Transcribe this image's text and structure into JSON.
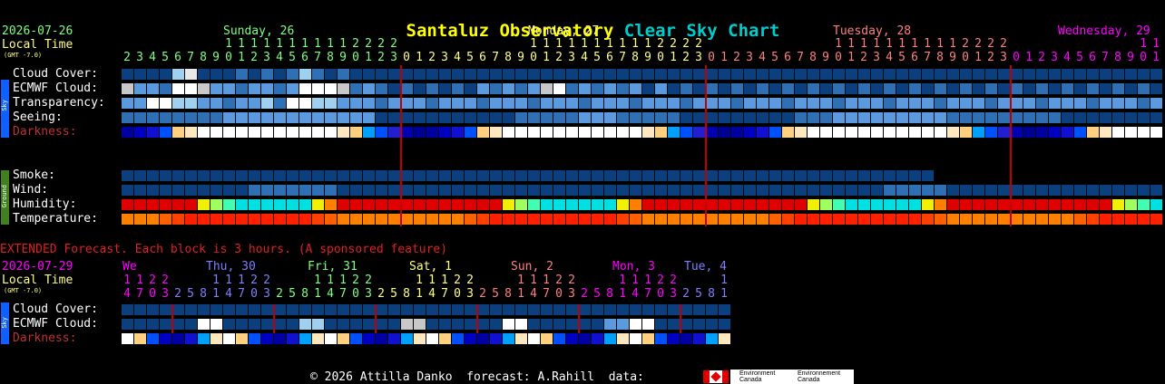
{
  "header": {
    "title_left": "Santaluz Observatory",
    "title_right": "Clear Sky Chart",
    "title_left_color": "#ffff00",
    "title_right_color": "#00cccc"
  },
  "top": {
    "date": "2026-07-26",
    "local_time": "Local Time",
    "gmt": "(GMT -7.0)",
    "days": [
      {
        "label": "Sunday, 26",
        "color": "#7fff7f"
      },
      {
        "label": "Monday, 27",
        "color": "#ffff7f"
      },
      {
        "label": "Tuesday, 28",
        "color": "#ff7f7f"
      },
      {
        "label": "Wednesday, 29",
        "color": "#ff00ff"
      }
    ],
    "hours": [
      "2",
      "3",
      "4",
      "5",
      "6",
      "7",
      "8",
      "9",
      "10",
      "11",
      "12",
      "13",
      "14",
      "15",
      "16",
      "17",
      "18",
      "19",
      "20",
      "21",
      "22",
      "23",
      "0",
      "1",
      "2",
      "3",
      "4",
      "5",
      "6",
      "7",
      "8",
      "9",
      "10",
      "11",
      "12",
      "13",
      "14",
      "15",
      "16",
      "17",
      "18",
      "19",
      "20",
      "21",
      "22",
      "23",
      "0",
      "1",
      "2",
      "3",
      "4",
      "5",
      "6",
      "7",
      "8",
      "9",
      "10",
      "11",
      "12",
      "13",
      "14",
      "15",
      "16",
      "17",
      "18",
      "19",
      "20",
      "21",
      "22",
      "23",
      "0",
      "1",
      "2",
      "3",
      "4",
      "5",
      "6",
      "7",
      "8",
      "9",
      "10",
      "11"
    ],
    "hour_colors": [
      "#7fff7f",
      "#ffff7f",
      "#ff7f7f",
      "#ff00ff"
    ],
    "sky_tag": "Sky",
    "ground_tag": "Ground",
    "rows": [
      {
        "label": "Cloud Cover:",
        "color": "#ffffff"
      },
      {
        "label": "ECMWF Cloud:",
        "color": "#ffffff"
      },
      {
        "label": "Transparency:",
        "color": "#ffffff"
      },
      {
        "label": "Seeing:",
        "color": "#ffffff"
      },
      {
        "label": "Darkness:",
        "color": "#c03030"
      },
      {
        "label": "Smoke:",
        "color": "#ffffff"
      },
      {
        "label": "Wind:",
        "color": "#ffffff"
      },
      {
        "label": "Humidity:",
        "color": "#ffffff"
      },
      {
        "label": "Temperature:",
        "color": "#ffffff"
      }
    ]
  },
  "extended": {
    "notice": "EXTENDED Forecast. Each block is 3 hours. (A sponsored feature)",
    "notice_color": "#e02020",
    "date": "2026-07-29",
    "local_time": "Local Time",
    "gmt": "(GMT -7.0)",
    "days": [
      {
        "label": "We",
        "color": "#ff00ff"
      },
      {
        "label": "Thu, 30",
        "color": "#7f7fff"
      },
      {
        "label": "Fri, 31",
        "color": "#7fff7f"
      },
      {
        "label": "Sat, 1",
        "color": "#ffff7f"
      },
      {
        "label": "Sun, 2",
        "color": "#ff7f7f"
      },
      {
        "label": "Mon, 3",
        "color": "#ff00ff"
      },
      {
        "label": "Tue, 4",
        "color": "#7f7fff"
      }
    ],
    "hours": [
      "14",
      "17",
      "20",
      "23",
      "2",
      "5",
      "8",
      "11",
      "14",
      "17",
      "20",
      "23",
      "2",
      "5",
      "8",
      "11",
      "14",
      "17",
      "20",
      "23",
      "2",
      "5",
      "8",
      "11",
      "14",
      "17",
      "20",
      "23",
      "2",
      "5",
      "8",
      "11",
      "14",
      "17",
      "20",
      "23",
      "2",
      "5",
      "8",
      "11",
      "14",
      "17",
      "20",
      "23",
      "2",
      "5",
      "8",
      "11"
    ],
    "sky_tag": "Sky",
    "rows": [
      {
        "label": "Cloud Cover:",
        "color": "#ffffff"
      },
      {
        "label": "ECMWF Cloud:",
        "color": "#ffffff"
      },
      {
        "label": "Darkness:",
        "color": "#c03030"
      }
    ]
  },
  "footer": {
    "text": "© 2026 Attilla Danko  forecast: A.Rahill  data:",
    "env1": "Environment Canada",
    "env2": "Environnement Canada"
  }
}
